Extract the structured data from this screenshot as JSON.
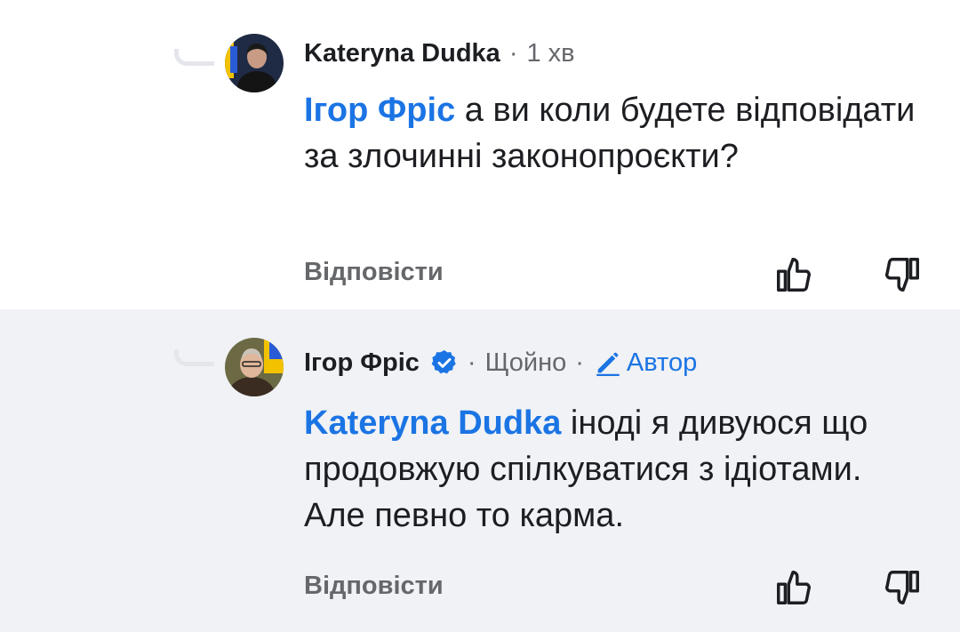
{
  "comments": [
    {
      "author": "Kateryna Dudka",
      "time": "1 хв",
      "mention": "Ігор Фріс",
      "text": " а ви коли будете відповідати за злочинні законопроєкти?",
      "reply_label": "Відповісти"
    },
    {
      "author": "Ігор Фріс",
      "time": "Щойно",
      "author_badge": "Автор",
      "mention": "Kateryna Dudka",
      "text": " іноді я дивуюся що продовжую спілкуватися з ідіотами. Але певно то карма.",
      "reply_label": "Відповісти"
    }
  ],
  "separator": "·",
  "colors": {
    "link": "#1b74e4",
    "thread_line": "#e4e6eb",
    "highlight_bg": "#f0f2f5"
  },
  "icons": [
    "like-icon",
    "dislike-icon",
    "verified-badge-icon",
    "pencil-icon"
  ]
}
